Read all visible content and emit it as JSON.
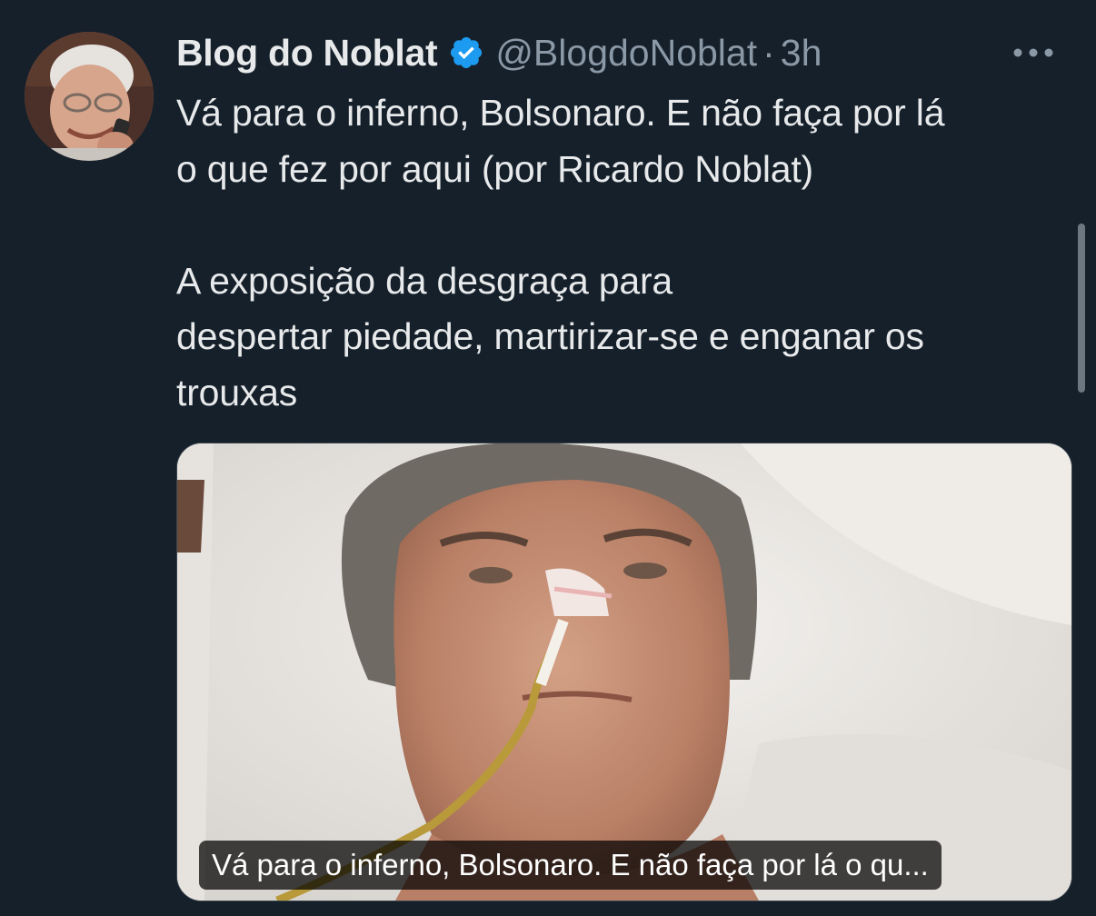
{
  "tweet": {
    "display_name": "Blog do Noblat",
    "verified_icon": "verified-badge-icon",
    "handle": "@BlogdoNoblat",
    "separator": "·",
    "timestamp": "3h",
    "more_icon": "more-horizontal-icon",
    "text_lines": [
      "Vá para o inferno, Bolsonaro. E não faça por lá",
      "o que fez por aqui (por Ricardo Noblat)",
      "A exposição da desgraça para",
      "despertar piedade, martirizar-se e enganar os",
      "trouxas"
    ],
    "media": {
      "caption": "Vá para o inferno, Bolsonaro. E não faça por lá o qu..."
    }
  },
  "colors": {
    "background": "#15202b",
    "text": "#e7e9ea",
    "secondary_text": "#8b98a5",
    "verified": "#1d9bf0"
  }
}
